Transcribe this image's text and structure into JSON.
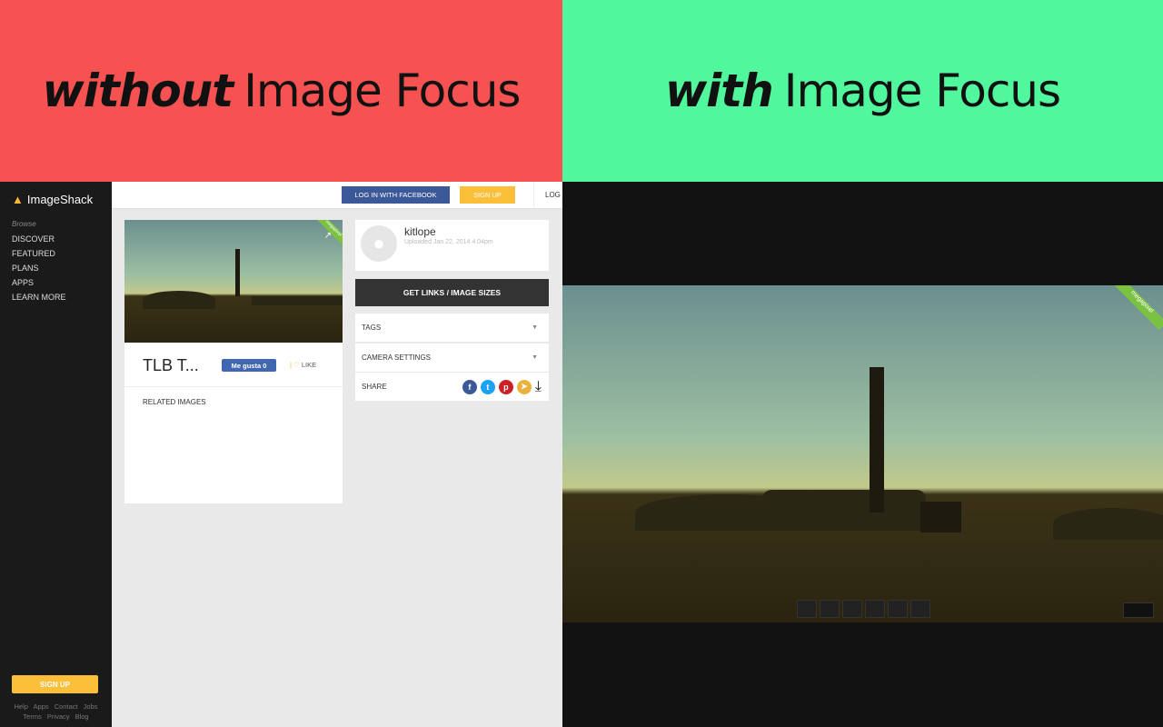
{
  "banners": {
    "left_em": "without",
    "left_rest": "Image Focus",
    "right_em": "with",
    "right_rest": "Image Focus"
  },
  "colors": {
    "left_banner": "#f65252",
    "right_banner": "#50f79c",
    "accent": "#fbbf3a",
    "facebook": "#3b5998"
  },
  "sidebar": {
    "logo": "ImageShack",
    "browse": "Browse",
    "items": [
      "DISCOVER",
      "FEATURED",
      "PLANS",
      "APPS",
      "LEARN MORE"
    ],
    "signup": "SIGN UP",
    "footer1": "Help Apps Contact Jobs",
    "footer2": "Terms Privacy Blog"
  },
  "topbar": {
    "facebook": "LOG IN WITH FACEBOOK",
    "signup": "SIGN UP",
    "login": "LOG"
  },
  "image": {
    "title": "TLB T...",
    "fb_like": "Me gusta 0",
    "like": "LIKE",
    "related": "RELATED IMAGES",
    "ribbon": "megapixel"
  },
  "user": {
    "name": "kitlope",
    "uploaded": "Uploaded Jan 22, 2014 4:04pm"
  },
  "panel": {
    "get_links": "GET LINKS / IMAGE SIZES",
    "tags": "TAGS",
    "camera": "CAMERA SETTINGS",
    "share": "SHARE"
  }
}
